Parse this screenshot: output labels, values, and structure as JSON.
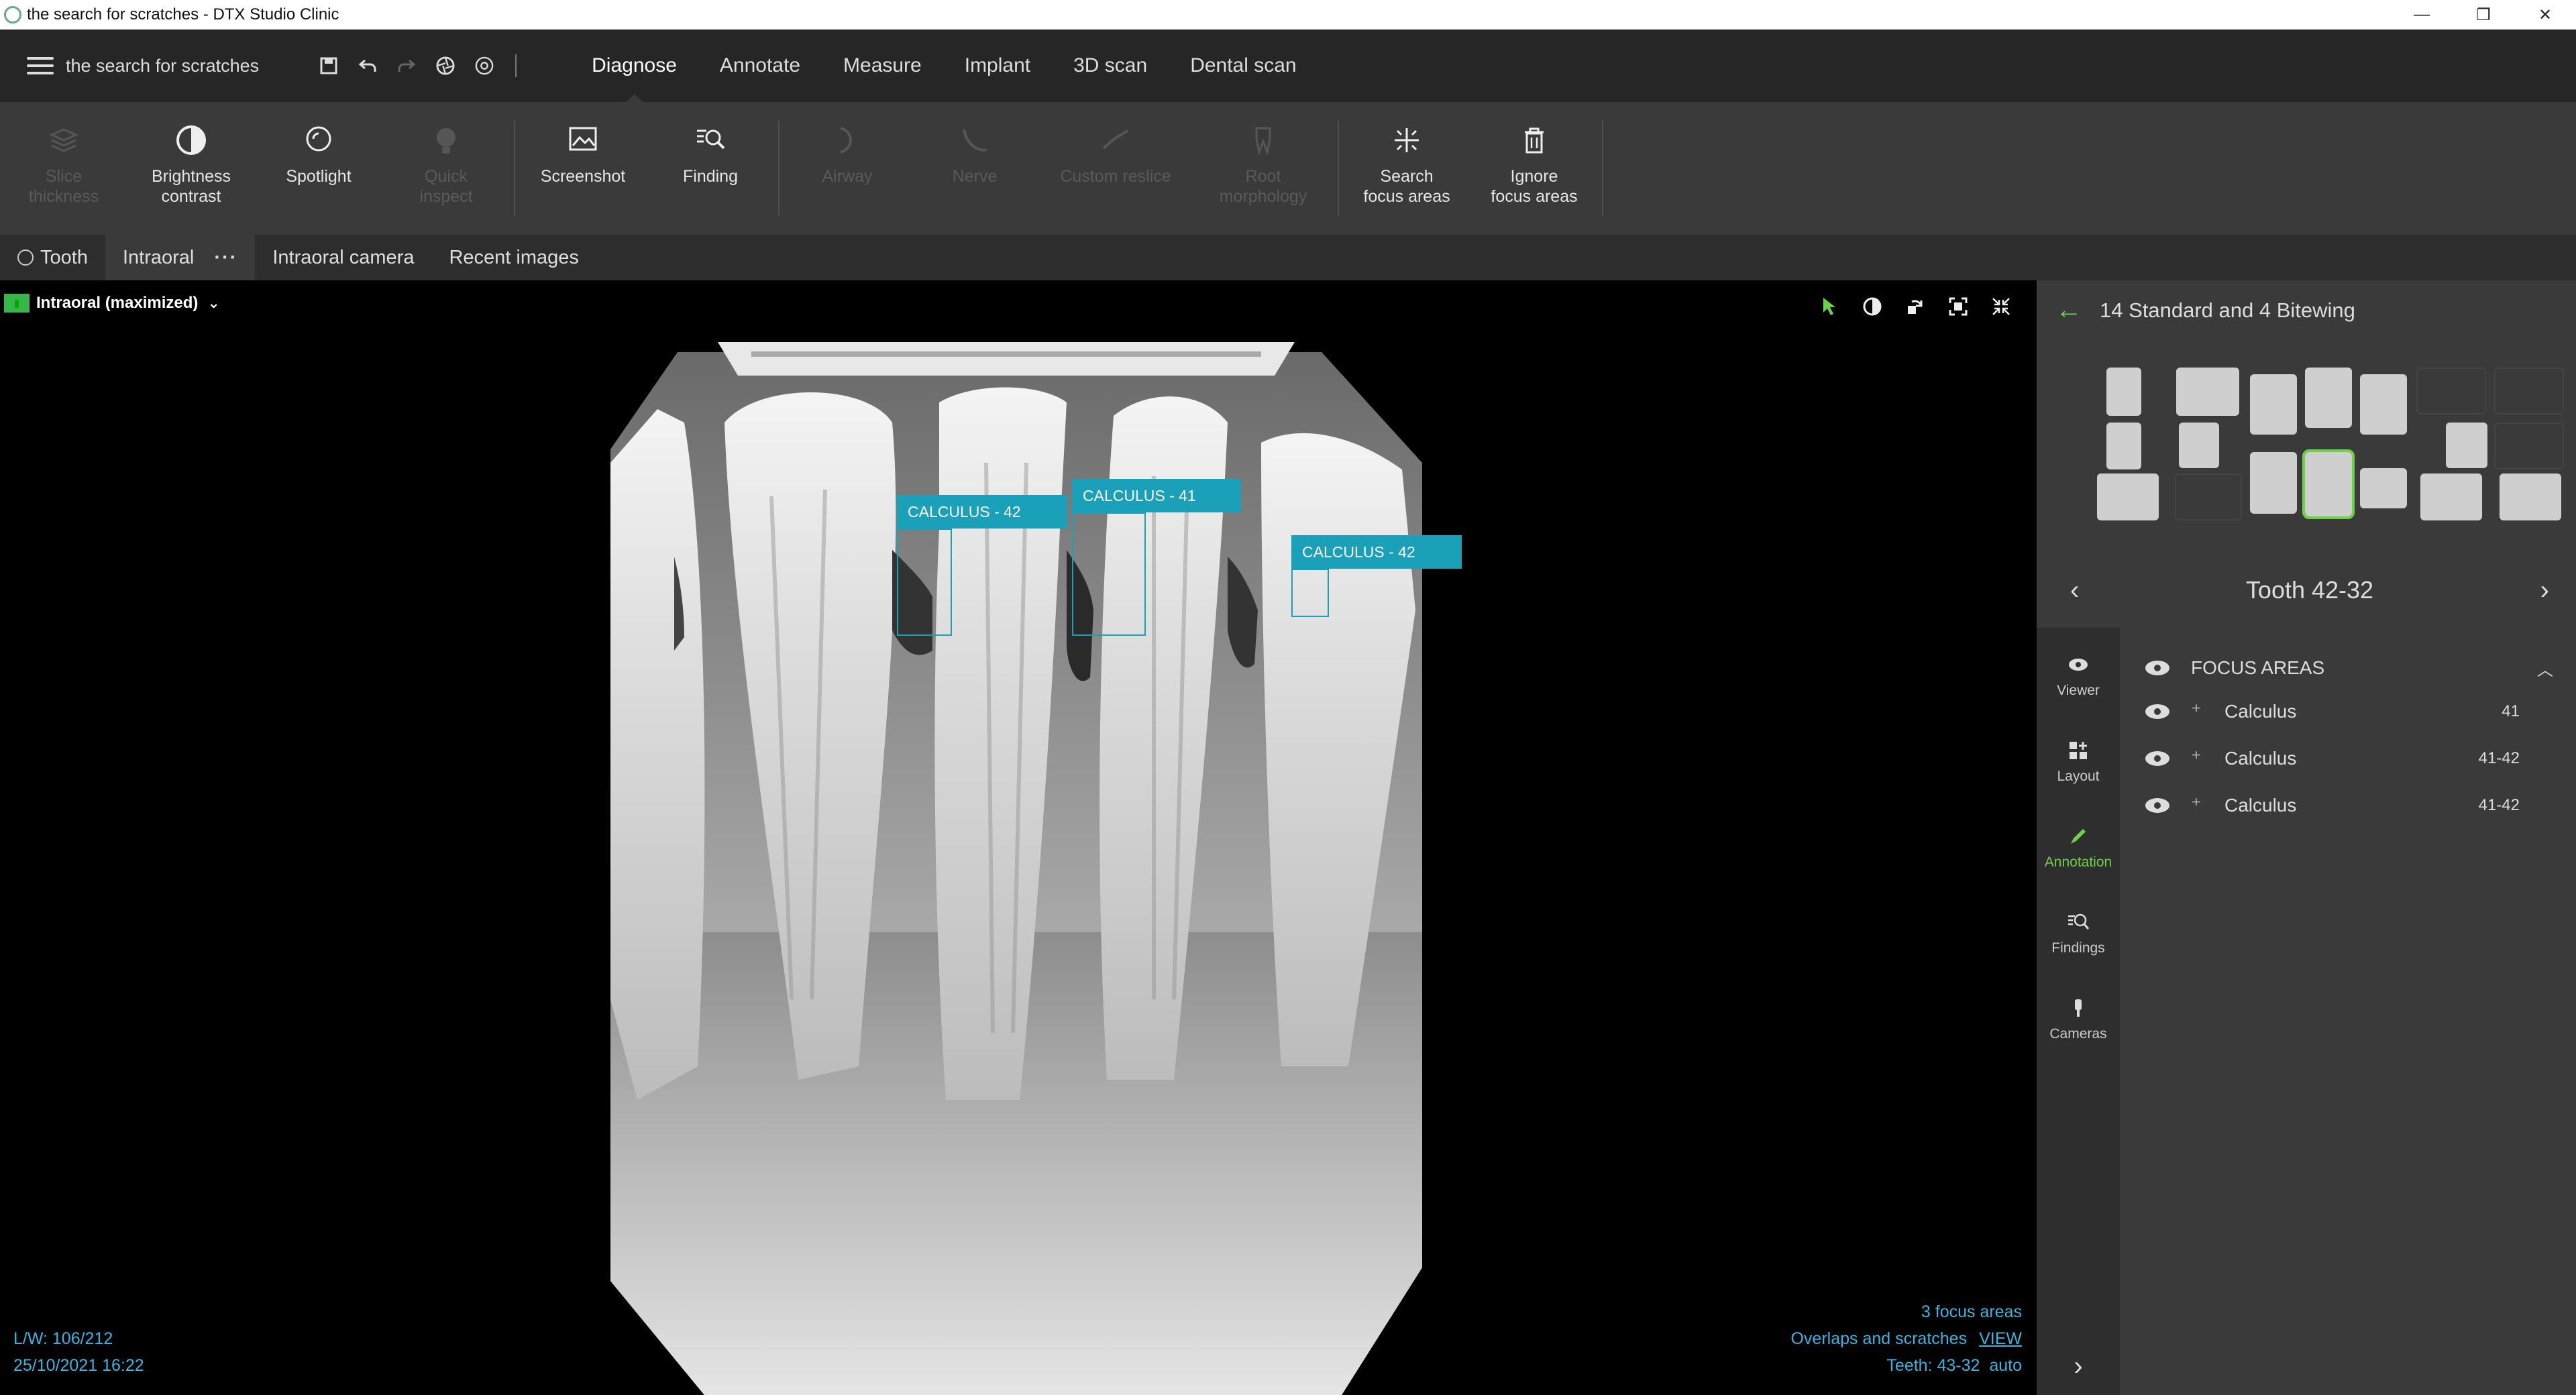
{
  "window": {
    "title": "the search for scratches - DTX Studio Clinic",
    "controls": [
      "—",
      "❐",
      "✕"
    ]
  },
  "navbar": {
    "project_name": "the search for scratches",
    "modes": [
      "Diagnose",
      "Annotate",
      "Measure",
      "Implant",
      "3D scan",
      "Dental scan"
    ],
    "active_mode": "Diagnose"
  },
  "ribbon": {
    "tools": [
      {
        "label": "Slice\nthickness",
        "icon": "layers-icon",
        "enabled": false
      },
      {
        "label": "Brightness\ncontrast",
        "icon": "contrast-icon",
        "enabled": true
      },
      {
        "label": "Spotlight",
        "icon": "spotlight-icon",
        "enabled": true
      },
      {
        "label": "Quick\ninspect",
        "icon": "inspect-icon",
        "enabled": false
      },
      {
        "label": "Screenshot",
        "icon": "screenshot-icon",
        "enabled": true
      },
      {
        "label": "Finding",
        "icon": "finding-icon",
        "enabled": true
      },
      {
        "label": "Airway",
        "icon": "airway-icon",
        "enabled": false
      },
      {
        "label": "Nerve",
        "icon": "nerve-icon",
        "enabled": false
      },
      {
        "label": "Custom reslice",
        "icon": "reslice-icon",
        "enabled": false
      },
      {
        "label": "Root\nmorphology",
        "icon": "root-icon",
        "enabled": false
      },
      {
        "label": "Search\nfocus areas",
        "icon": "sparkle-icon",
        "enabled": true
      },
      {
        "label": "Ignore\nfocus areas",
        "icon": "trash-icon",
        "enabled": true
      }
    ]
  },
  "subtabs": {
    "tooth": "Tooth",
    "intraoral": "Intraoral",
    "more": "···",
    "intraoral_camera": "Intraoral camera",
    "recent_images": "Recent images"
  },
  "viewer": {
    "layout_label": "Intraoral (maximized)",
    "annotations": [
      {
        "label": "CALCULUS - 42"
      },
      {
        "label": "CALCULUS - 41"
      },
      {
        "label": "CALCULUS - 42"
      }
    ],
    "bottom_left": {
      "lw": "L/W: 106/212",
      "datetime": "25/10/2021 16:22"
    },
    "bottom_right": {
      "focus_count": "3 focus areas",
      "overlaps": "Overlaps and scratches",
      "view_link": "VIEW",
      "teeth": "Teeth: 43-32",
      "auto": "auto"
    },
    "accent_color": "#1aa0b8"
  },
  "right_panel": {
    "series_title": "14 Standard and 4 Bitewing",
    "tooth_label": "Tooth 42-32",
    "side_tabs": [
      {
        "label": "Viewer",
        "icon": "eye-icon"
      },
      {
        "label": "Layout",
        "icon": "layout-icon"
      },
      {
        "label": "Annotation",
        "icon": "pencil-icon",
        "active": true
      },
      {
        "label": "Findings",
        "icon": "findings-icon"
      },
      {
        "label": "Cameras",
        "icon": "camera-icon"
      }
    ],
    "focus_areas": {
      "title": "FOCUS AREAS",
      "items": [
        {
          "name": "Calculus",
          "teeth": "41"
        },
        {
          "name": "Calculus",
          "teeth": "41-42"
        },
        {
          "name": "Calculus",
          "teeth": "41-42"
        }
      ]
    },
    "accent_color": "#6dd14a"
  }
}
